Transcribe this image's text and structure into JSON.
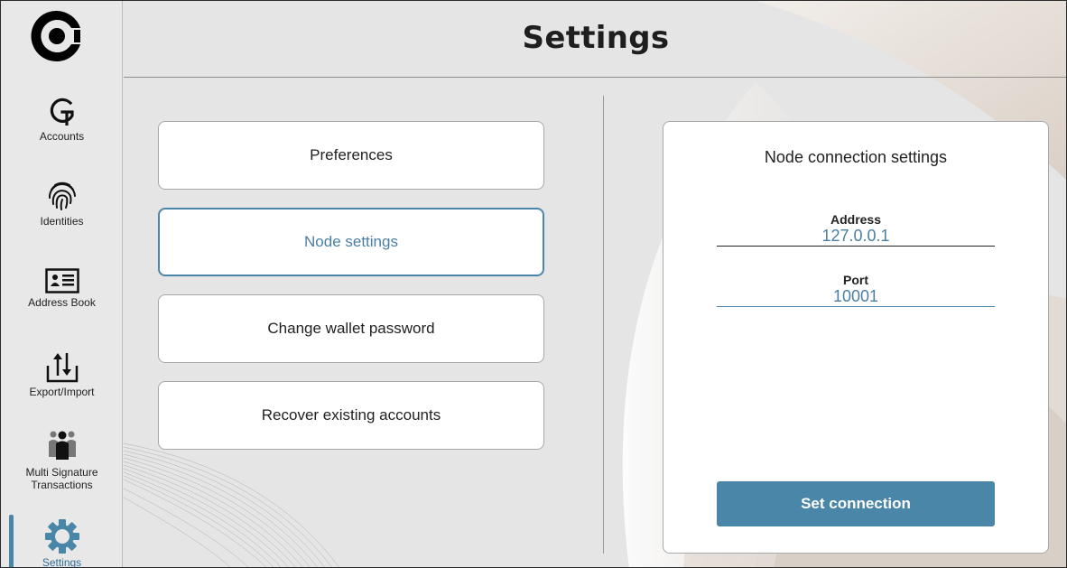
{
  "header": {
    "title": "Settings"
  },
  "sidebar": {
    "items": [
      {
        "label": "Accounts",
        "icon": "accounts-g-icon"
      },
      {
        "label": "Identities",
        "icon": "fingerprint-icon"
      },
      {
        "label": "Address Book",
        "icon": "id-card-icon"
      },
      {
        "label": "Export/Import",
        "icon": "export-import-arrows-icon"
      },
      {
        "label": "Multi Signature\nTransactions",
        "label_line1": "Multi Signature",
        "label_line2": "Transactions",
        "icon": "people-group-icon"
      },
      {
        "label": "Settings",
        "icon": "gear-icon",
        "active": true
      }
    ]
  },
  "menu": {
    "preferences": "Preferences",
    "node_settings": "Node settings",
    "change_password": "Change wallet password",
    "recover_accounts": "Recover existing accounts",
    "active_item": "node_settings"
  },
  "node_panel": {
    "title": "Node connection settings",
    "address_label": "Address",
    "address_value": "127.0.0.1",
    "port_label": "Port",
    "port_value": "10001",
    "submit_label": "Set connection"
  },
  "colors": {
    "accent": "#4a86a8",
    "accent_text": "#4a7fa3",
    "background": "#e5e5e5",
    "sidebar_background": "#e8e8e8"
  }
}
